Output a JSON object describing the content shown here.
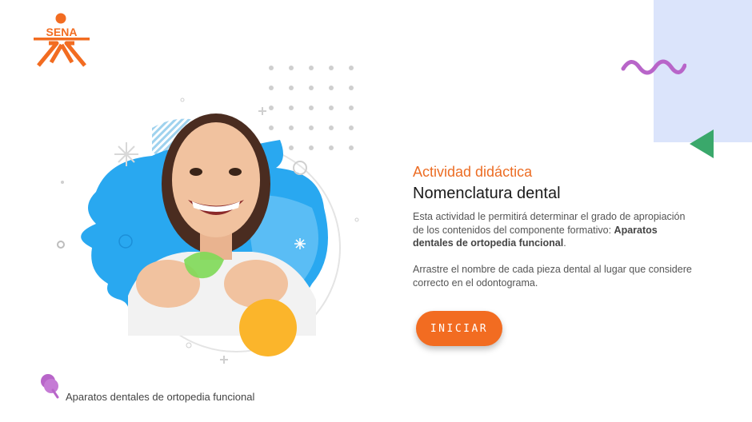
{
  "logo": {
    "text": "SENA",
    "color": "#f26c21"
  },
  "activity": {
    "subtitle": "Actividad didáctica",
    "title": "Nomenclatura dental",
    "description_part1": "Esta actividad le permitirá determinar el grado de apropiación de los contenidos del componente formativo: ",
    "description_bold": "Aparatos dentales de ortopedia funcional",
    "description_end": ".",
    "instructions": "Arrastre el nombre de cada pieza dental al lugar que considere correcto en el odontograma."
  },
  "start_button": {
    "label": "INICIAR",
    "color": "#f26c21"
  },
  "footer": {
    "label": "Aparatos dentales de ortopedia funcional",
    "icon": "pin-icon"
  },
  "colors": {
    "accent": "#ec6d24",
    "decor_blue": "#dbe4fb",
    "decor_purple": "#b865c9",
    "decor_green": "#3aa86b",
    "blob_blue": "#29a8f0",
    "circle_yellow": "#fbb52b"
  }
}
